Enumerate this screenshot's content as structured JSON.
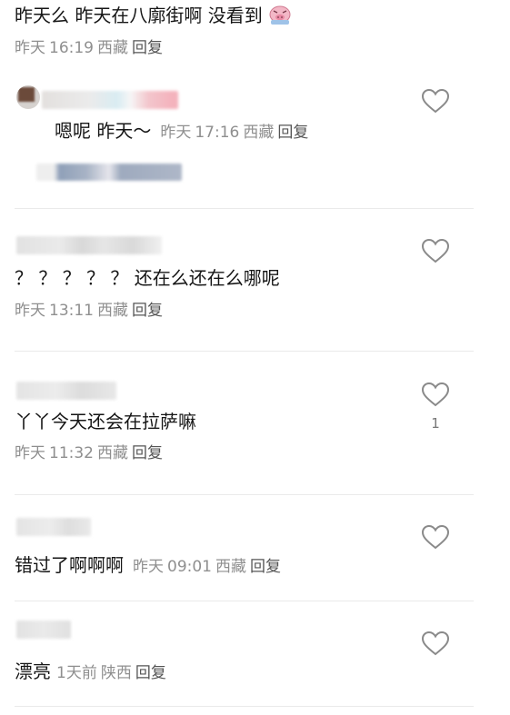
{
  "comments": [
    {
      "text": "昨天么 昨天在八廓街啊 没看到",
      "emoji": "emoji-pig-icon",
      "date": "昨天",
      "time": "16:19",
      "location": "西藏",
      "reply": "回复"
    },
    {
      "text": "嗯呢 昨天～",
      "date": "昨天",
      "time": "17:16",
      "location": "西藏",
      "reply": "回复"
    },
    {
      "text": "？ ？ ？ ？ ？ 还在么还在么哪呢",
      "date": "昨天",
      "time": "13:11",
      "location": "西藏",
      "reply": "回复"
    },
    {
      "text": "丫丫今天还会在拉萨嘛",
      "date": "昨天",
      "time": "11:32",
      "location": "西藏",
      "reply": "回复",
      "likes": "1"
    },
    {
      "text": "错过了啊啊啊",
      "date": "昨天",
      "time": "09:01",
      "location": "西藏",
      "reply": "回复"
    },
    {
      "text": "漂亮",
      "date": "1天前",
      "location": "陕西",
      "reply": "回复"
    }
  ],
  "colors": {
    "text": "#161616",
    "meta": "#8f8f8f",
    "divider": "#eaeaea",
    "heart": "#8a8a8a"
  }
}
